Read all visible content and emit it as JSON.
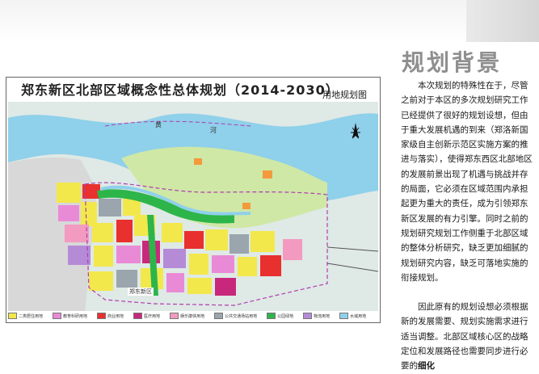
{
  "slide": {
    "title": "规划背景"
  },
  "map": {
    "title": "郑东新区北部区域概念性总体规划（2014-2030）",
    "subtitle": "用地规划图",
    "river_label_1": "黄",
    "river_label_2": "河",
    "district_label": "郑东新区",
    "legend": [
      {
        "label": "二类居住用地",
        "color": "#f2e84b"
      },
      {
        "label": "教育科研用地",
        "color": "#e98ad6"
      },
      {
        "label": "商业用地",
        "color": "#e8302e"
      },
      {
        "label": "医疗用地",
        "color": "#c8287c"
      },
      {
        "label": "娱乐康体用地",
        "color": "#f39ac0"
      },
      {
        "label": "公共交通场站用地",
        "color": "#9aa5ad"
      },
      {
        "label": "公园绿地",
        "color": "#2db54a"
      },
      {
        "label": "物流用地",
        "color": "#b58bd8"
      },
      {
        "label": "水域用地",
        "color": "#8fd0ea"
      }
    ]
  },
  "text": {
    "para1": "本次规划的特殊性在于，尽管之前对于本区的多次规划研究工作已经提供了很好的规划设想，但由于重大发展机遇的到来（郑洛新国家级自主创新示范区实施方案的推进与落实），使得郑东西区北部地区的发展前景出现了机遇与挑战并存的局面，它必须在区域范围内承担起更为重大的责任，成为引领郑东新区发展的有力引擎。同时之前的规划研究规划工作侧重于北部区域的整体分析研究，缺乏更加细腻的规划研究内容，缺乏可落地实施的衔接规划。",
    "para2_main": "因此原有的规划设想必须根据新的发展需要、规划实施需求进行适当调整。北部区域核心区的战略定位和发展路径也需要同步进行必要的",
    "para2_bold": "细化"
  },
  "colors": {
    "title_gray": "#8f8f8f",
    "water": "#8fd0ea",
    "green_land": "#cfe8a6"
  }
}
